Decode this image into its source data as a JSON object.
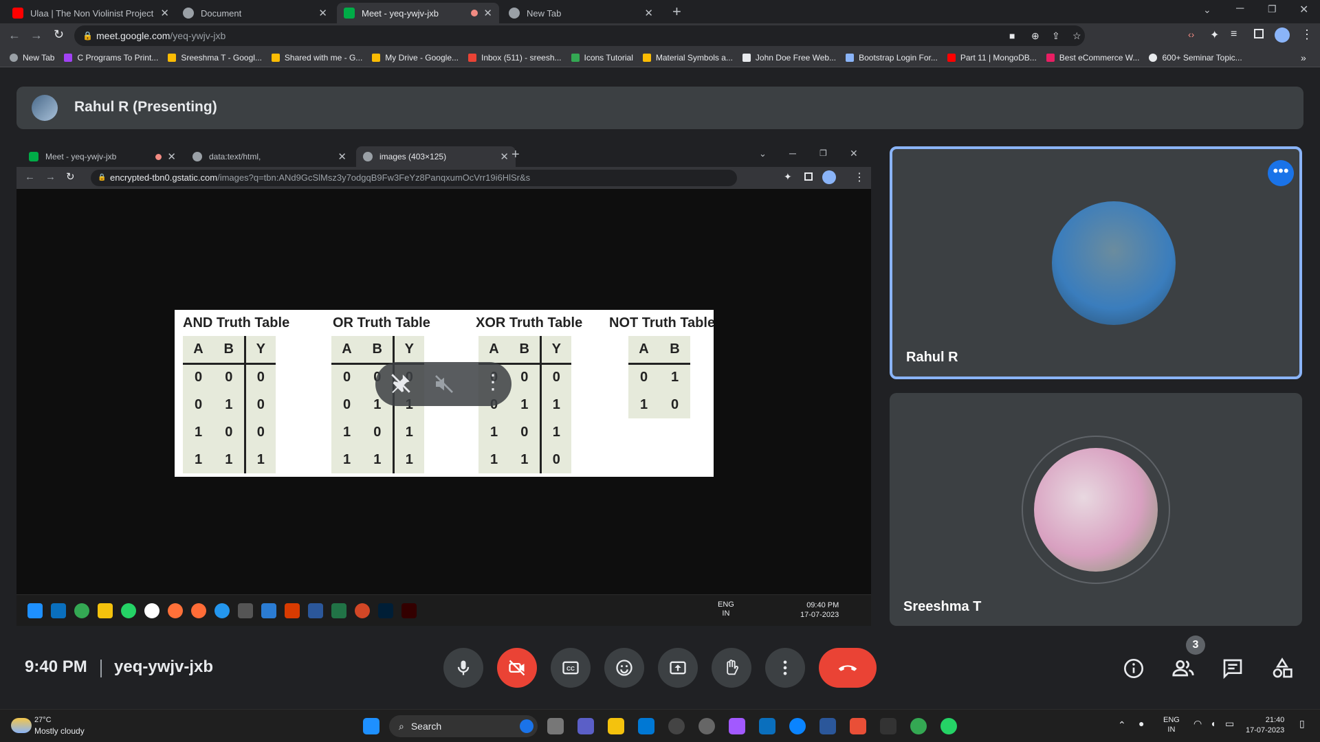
{
  "browser": {
    "tabs": [
      {
        "title": "Ulaa | The Non Violinist Project ft",
        "active": false
      },
      {
        "title": "Document",
        "active": false
      },
      {
        "title": "Meet - yeq-ywjv-jxb",
        "active": true
      },
      {
        "title": "New Tab",
        "active": false
      }
    ],
    "url_host": "meet.google.com",
    "url_path": "/yeq-ywjv-jxb",
    "bookmarks": [
      "New Tab",
      "C Programs To Print...",
      "Sreeshma T - Googl...",
      "Shared with me - G...",
      "My Drive - Google...",
      "Inbox (511) - sreesh...",
      "Icons Tutorial",
      "Material Symbols a...",
      "John Doe Free Web...",
      "Bootstrap Login For...",
      "Part 11 | MongoDB...",
      "Best eCommerce W...",
      "600+ Seminar Topic..."
    ]
  },
  "meet": {
    "presenter_label": "Rahul R (Presenting)",
    "time": "9:40 PM",
    "code": "yeq-ywjv-jxb",
    "participant_count": "3",
    "tiles": [
      {
        "name": "Rahul R"
      },
      {
        "name": "Sreeshma T"
      }
    ]
  },
  "shared_screen": {
    "tabs": [
      {
        "title": "Meet - yeq-ywjv-jxb"
      },
      {
        "title": "data:text/html,"
      },
      {
        "title": "images (403×125)"
      }
    ],
    "url_host": "encrypted-tbn0.gstatic.com",
    "url_path": "/images?q=tbn:ANd9GcSlMsz3y7odgqB9Fw3FeYz8PanqxumOcVrr19i6HlSr&s",
    "truth_tables": [
      {
        "title": "AND Truth Table",
        "headers": [
          "A",
          "B",
          "Y"
        ],
        "rows": [
          [
            "0",
            "0",
            "0"
          ],
          [
            "0",
            "1",
            "0"
          ],
          [
            "1",
            "0",
            "0"
          ],
          [
            "1",
            "1",
            "1"
          ]
        ]
      },
      {
        "title": "OR Truth Table",
        "headers": [
          "A",
          "B",
          "Y"
        ],
        "rows": [
          [
            "0",
            "0",
            "0"
          ],
          [
            "0",
            "1",
            "1"
          ],
          [
            "1",
            "0",
            "1"
          ],
          [
            "1",
            "1",
            "1"
          ]
        ]
      },
      {
        "title": "XOR Truth Table",
        "headers": [
          "A",
          "B",
          "Y"
        ],
        "rows": [
          [
            "0",
            "0",
            "0"
          ],
          [
            "0",
            "1",
            "1"
          ],
          [
            "1",
            "0",
            "1"
          ],
          [
            "1",
            "1",
            "0"
          ]
        ]
      },
      {
        "title": "NOT Truth Table",
        "headers": [
          "A",
          "B"
        ],
        "rows": [
          [
            "0",
            "1"
          ],
          [
            "1",
            "0"
          ]
        ]
      }
    ],
    "taskbar": {
      "lang": "ENG",
      "region": "IN",
      "time": "09:40 PM",
      "date": "17-07-2023"
    }
  },
  "taskbar": {
    "weather_temp": "27°C",
    "weather_desc": "Mostly cloudy",
    "search_label": "Search",
    "lang": "ENG",
    "region": "IN",
    "time": "21:40",
    "date": "17-07-2023"
  },
  "colors": {
    "accent": "#8ab4f8",
    "end_call": "#ea4335",
    "meet_bg": "#202124"
  }
}
